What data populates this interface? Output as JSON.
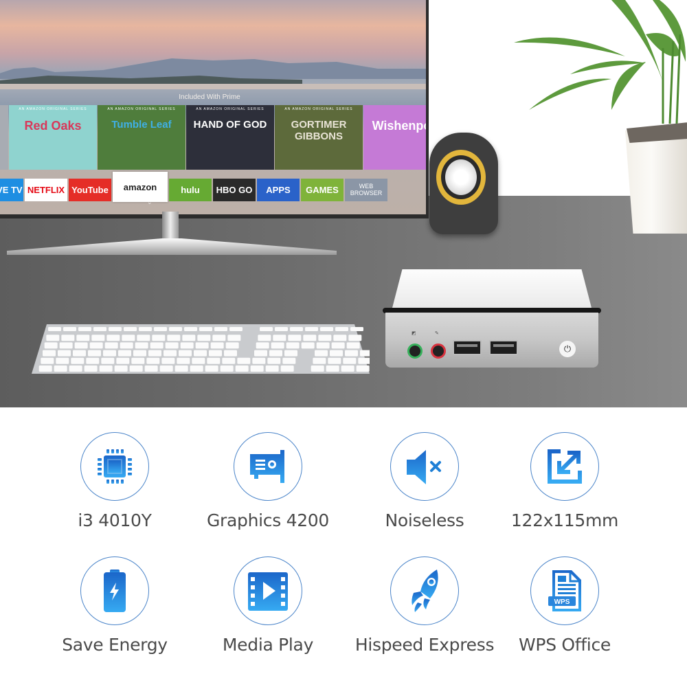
{
  "scene": {
    "monitor": {
      "section_title": "Included With Prime",
      "tiles": [
        {
          "caption": "",
          "title": "",
          "bg": "#a8acb3"
        },
        {
          "caption": "AN AMAZON ORIGINAL SERIES",
          "title": "Red Oaks",
          "bg": "#8fd3cf",
          "title_color": "#d9385a"
        },
        {
          "caption": "AN AMAZON ORIGINAL SERIES",
          "title": "Tumble Leaf",
          "bg": "#4f7d3c",
          "title_color": "#3fb0e6"
        },
        {
          "caption": "AN AMAZON ORIGINAL SERIES",
          "title": "HAND OF GOD",
          "bg": "#2d2f3a",
          "title_color": "#ffffff"
        },
        {
          "caption": "AN AMAZON ORIGINAL SERIES",
          "title": "GORTIMER GIBBONS",
          "bg": "#5d6a3b",
          "title_color": "#e9e4d6"
        },
        {
          "caption": "",
          "title": "Wishenpoof",
          "bg": "#c57ad6",
          "title_color": "#ffffff"
        }
      ],
      "apps": [
        {
          "label": "IVE TV",
          "bg": "#1e8ee2",
          "color": "#ffffff",
          "width": 44
        },
        {
          "label": "NETFLIX",
          "bg": "#ffffff",
          "color": "#e50914",
          "width": 62
        },
        {
          "label": "YouTube",
          "bg": "#e52d27",
          "color": "#ffffff",
          "width": 62
        },
        {
          "label": "amazon",
          "bg": "#ffffff",
          "color": "#222222",
          "width": 80,
          "selected": true
        },
        {
          "label": "hulu",
          "bg": "#66aa33",
          "color": "#ffffff",
          "width": 62
        },
        {
          "label": "HBO GO",
          "bg": "#2a2a2a",
          "color": "#ffffff",
          "width": 62
        },
        {
          "label": "APPS",
          "bg": "#2a62c9",
          "color": "#ffffff",
          "width": 62
        },
        {
          "label": "GAMES",
          "bg": "#7fb33a",
          "color": "#ffffff",
          "width": 62
        },
        {
          "label": "WEB BROWSER",
          "bg": "#8b96a6",
          "color": "#ffffff",
          "width": 62
        }
      ]
    }
  },
  "features": [
    {
      "label": "i3 4010Y",
      "icon": "cpu-icon"
    },
    {
      "label": "Graphics 4200",
      "icon": "graphics-card-icon"
    },
    {
      "label": "Noiseless",
      "icon": "speaker-mute-icon"
    },
    {
      "label": "122x115mm",
      "icon": "resize-arrow-icon"
    },
    {
      "label": "Save Energy",
      "icon": "battery-icon"
    },
    {
      "label": "Media Play",
      "icon": "film-play-icon"
    },
    {
      "label": "Hispeed Express",
      "icon": "rocket-icon"
    },
    {
      "label": "WPS Office",
      "icon": "wps-document-icon"
    }
  ],
  "colors": {
    "accent": "#1e7fd6",
    "accent_light": "#34a7f2",
    "label": "#4a4a4a"
  }
}
